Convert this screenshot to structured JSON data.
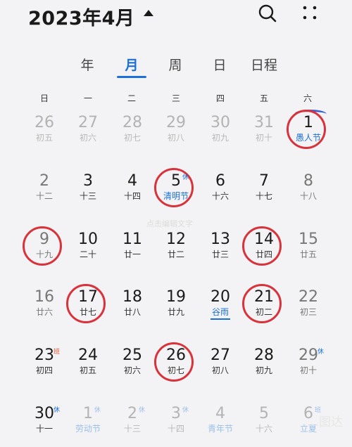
{
  "header": {
    "title": "2023年4月"
  },
  "views": [
    {
      "label": "年",
      "active": false
    },
    {
      "label": "月",
      "active": true
    },
    {
      "label": "周",
      "active": false
    },
    {
      "label": "日",
      "active": false
    },
    {
      "label": "日程",
      "active": false
    }
  ],
  "weekdays": [
    "日",
    "一",
    "二",
    "三",
    "四",
    "五",
    "六"
  ],
  "weeks": [
    [
      {
        "day": "26",
        "lunar": "初五",
        "dim": true
      },
      {
        "day": "27",
        "lunar": "初六",
        "dim": true
      },
      {
        "day": "28",
        "lunar": "初七",
        "dim": true
      },
      {
        "day": "29",
        "lunar": "初八",
        "dim": true
      },
      {
        "day": "30",
        "lunar": "初九",
        "dim": true
      },
      {
        "day": "31",
        "lunar": "初十",
        "dim": true
      },
      {
        "day": "1",
        "lunar": "愚人节",
        "fest": true,
        "circled": true
      }
    ],
    [
      {
        "day": "2",
        "lunar": "十二",
        "weekend": true
      },
      {
        "day": "3",
        "lunar": "十三"
      },
      {
        "day": "4",
        "lunar": "十四"
      },
      {
        "day": "5",
        "lunar": "清明节",
        "fest": true,
        "badge": "休",
        "circled": true
      },
      {
        "day": "6",
        "lunar": "十六"
      },
      {
        "day": "7",
        "lunar": "十七"
      },
      {
        "day": "8",
        "lunar": "十八",
        "weekend": true
      }
    ],
    [
      {
        "day": "9",
        "lunar": "十九",
        "weekend": true,
        "circled": true
      },
      {
        "day": "10",
        "lunar": "二十"
      },
      {
        "day": "11",
        "lunar": "廿一"
      },
      {
        "day": "12",
        "lunar": "廿二"
      },
      {
        "day": "13",
        "lunar": "廿三"
      },
      {
        "day": "14",
        "lunar": "廿四",
        "circled": true
      },
      {
        "day": "15",
        "lunar": "廿五",
        "weekend": true
      }
    ],
    [
      {
        "day": "16",
        "lunar": "廿六",
        "weekend": true
      },
      {
        "day": "17",
        "lunar": "廿七",
        "circled": true
      },
      {
        "day": "18",
        "lunar": "廿八"
      },
      {
        "day": "19",
        "lunar": "廿九"
      },
      {
        "day": "20",
        "lunar": "谷雨",
        "fest": true,
        "term": true
      },
      {
        "day": "21",
        "lunar": "初二",
        "circled": true
      },
      {
        "day": "22",
        "lunar": "初三",
        "weekend": true
      }
    ],
    [
      {
        "day": "23",
        "lunar": "初四",
        "badge": "班",
        "work": true
      },
      {
        "day": "24",
        "lunar": "初五"
      },
      {
        "day": "25",
        "lunar": "初六"
      },
      {
        "day": "26",
        "lunar": "初七",
        "circled": true
      },
      {
        "day": "27",
        "lunar": "初八"
      },
      {
        "day": "28",
        "lunar": "初九"
      },
      {
        "day": "29",
        "lunar": "初十",
        "badge": "休",
        "weekend": true
      }
    ],
    [
      {
        "day": "30",
        "lunar": "十一",
        "badge": "休"
      },
      {
        "day": "1",
        "lunar": "劳动节",
        "fest": true,
        "badge": "休",
        "dim": true
      },
      {
        "day": "2",
        "lunar": "十三",
        "badge": "休",
        "dim": true
      },
      {
        "day": "3",
        "lunar": "十四",
        "badge": "休",
        "dim": true
      },
      {
        "day": "4",
        "lunar": "青年节",
        "fest": true,
        "dim": true
      },
      {
        "day": "5",
        "lunar": "十六",
        "dim": true
      },
      {
        "day": "6",
        "lunar": "立夏",
        "fest": true,
        "badge": "班",
        "work": true,
        "dim": true
      }
    ]
  ],
  "overlay_text": "点击编辑文字",
  "watermark": "…图达"
}
